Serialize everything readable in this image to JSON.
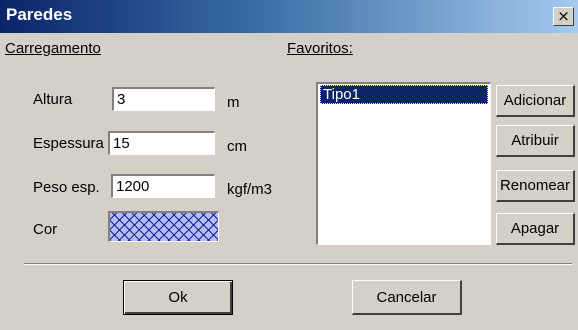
{
  "window": {
    "title": "Paredes",
    "close_label": "×"
  },
  "sections": {
    "load": "Carregamento",
    "favorites": "Favoritos:"
  },
  "fields": {
    "height": {
      "label": "Altura",
      "value": "3",
      "unit": "m"
    },
    "thickness": {
      "label": "Espessura",
      "value": "15",
      "unit": "cm"
    },
    "specific_weight": {
      "label": "Peso esp.",
      "value": "1200",
      "unit": "kgf/m3"
    },
    "color": {
      "label": "Cor",
      "swatch_color": "#b4bef8",
      "hatch_color": "#1b1f9c"
    }
  },
  "favorites": {
    "items": [
      "Tipo1"
    ],
    "selected": "Tipo1"
  },
  "side_buttons": {
    "add": "Adicionar",
    "assign": "Atribuir",
    "rename": "Renomear",
    "delete": "Apagar"
  },
  "footer": {
    "ok": "Ok",
    "cancel": "Cancelar"
  }
}
